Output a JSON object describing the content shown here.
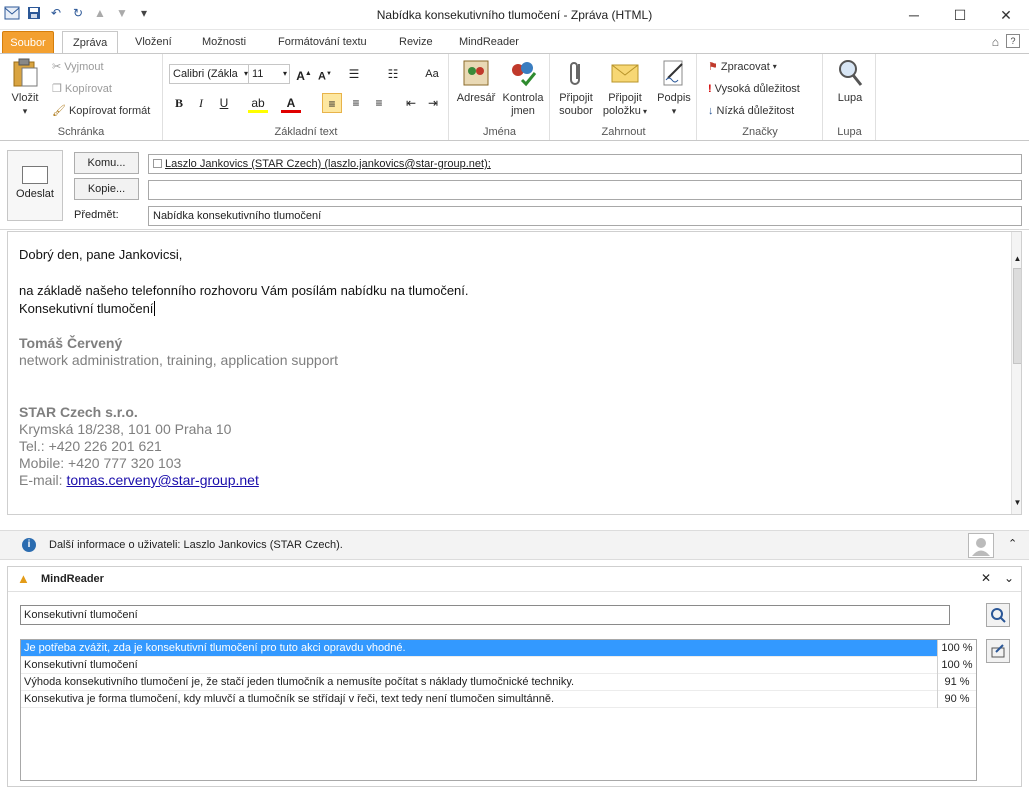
{
  "window": {
    "title": "Nabídka konsekutivního tlumočení  -  Zpráva (HTML)",
    "minimize": "─",
    "maximize": "☐",
    "close": "✕"
  },
  "tabs": [
    "Soubor",
    "Zpráva",
    "Vložení",
    "Možnosti",
    "Formátování textu",
    "Revize",
    "MindReader"
  ],
  "ribbon": {
    "clipboard": {
      "paste": "Vložit",
      "cut": "Vyjmout",
      "copy": "Kopírovat",
      "format_painter": "Kopírovat formát",
      "label": "Schránka"
    },
    "basic_text": {
      "font": "Calibri (Zákla",
      "size": "11",
      "label": "Základní text"
    },
    "names": {
      "address_book": "Adresář",
      "check_names_1": "Kontrola",
      "check_names_2": "jmen",
      "label": "Jména"
    },
    "include": {
      "attach_file_1": "Připojit",
      "attach_file_2": "soubor",
      "attach_item_1": "Připojit",
      "attach_item_2": "položku",
      "signature": "Podpis",
      "label": "Zahrnout"
    },
    "tags": {
      "followup": "Zpracovat",
      "high": "Vysoká důležitost",
      "low": "Nízká důležitost",
      "label": "Značky"
    },
    "zoom": {
      "zoom": "Lupa",
      "label": "Lupa"
    }
  },
  "message": {
    "send": "Odeslat",
    "to_btn": "Komu...",
    "cc_btn": "Kopie...",
    "subject_label": "Předmět:",
    "to_value": "Laszlo Jankovics (STAR Czech) (laszlo.jankovics@star-group.net);",
    "cc_value": "",
    "subject_value": "Nabídka konsekutivního tlumočení"
  },
  "body": {
    "greeting": "Dobrý den, pane Jankovicsi,",
    "line1": "na základě našeho telefonního rozhovoru Vám posílám nabídku na tlumočení.",
    "line2": "Konsekutivní tlumočení",
    "sig_name": "Tomáš Červený",
    "sig_role": "network administration, training, application support",
    "company": "STAR Czech s.r.o.",
    "address": "Krymská 18/238, 101 00 Praha 10",
    "tel": "Tel.: +420 226 201 621",
    "mobile": "Mobile: +420 777 320 103",
    "email_label": "E-mail: ",
    "email": "tomas.cerveny@star-group.net"
  },
  "people_bar": {
    "text": "Další informace o uživateli: Laszlo Jankovics (STAR Czech)."
  },
  "mindreader": {
    "title": "MindReader",
    "query": "Konsekutivní tlumočení",
    "results": [
      {
        "text": "Je potřeba zvážit, zda je konsekutivní tlumočení pro tuto akci opravdu vhodné.",
        "pct": "100 %",
        "selected": true
      },
      {
        "text": "Konsekutivní tlumočení",
        "pct": "100 %",
        "selected": false
      },
      {
        "text": "Výhoda konsekutivního tlumočení je, že stačí jeden tlumočník a nemusíte počítat s náklady tlumočnické techniky.",
        "pct": "91 %",
        "selected": false
      },
      {
        "text": "Konsekutiva je forma tlumočení, kdy mluvčí a tlumočník se střídají v řeči, text tedy není tlumočen simultánně.",
        "pct": "90 %",
        "selected": false
      }
    ]
  }
}
